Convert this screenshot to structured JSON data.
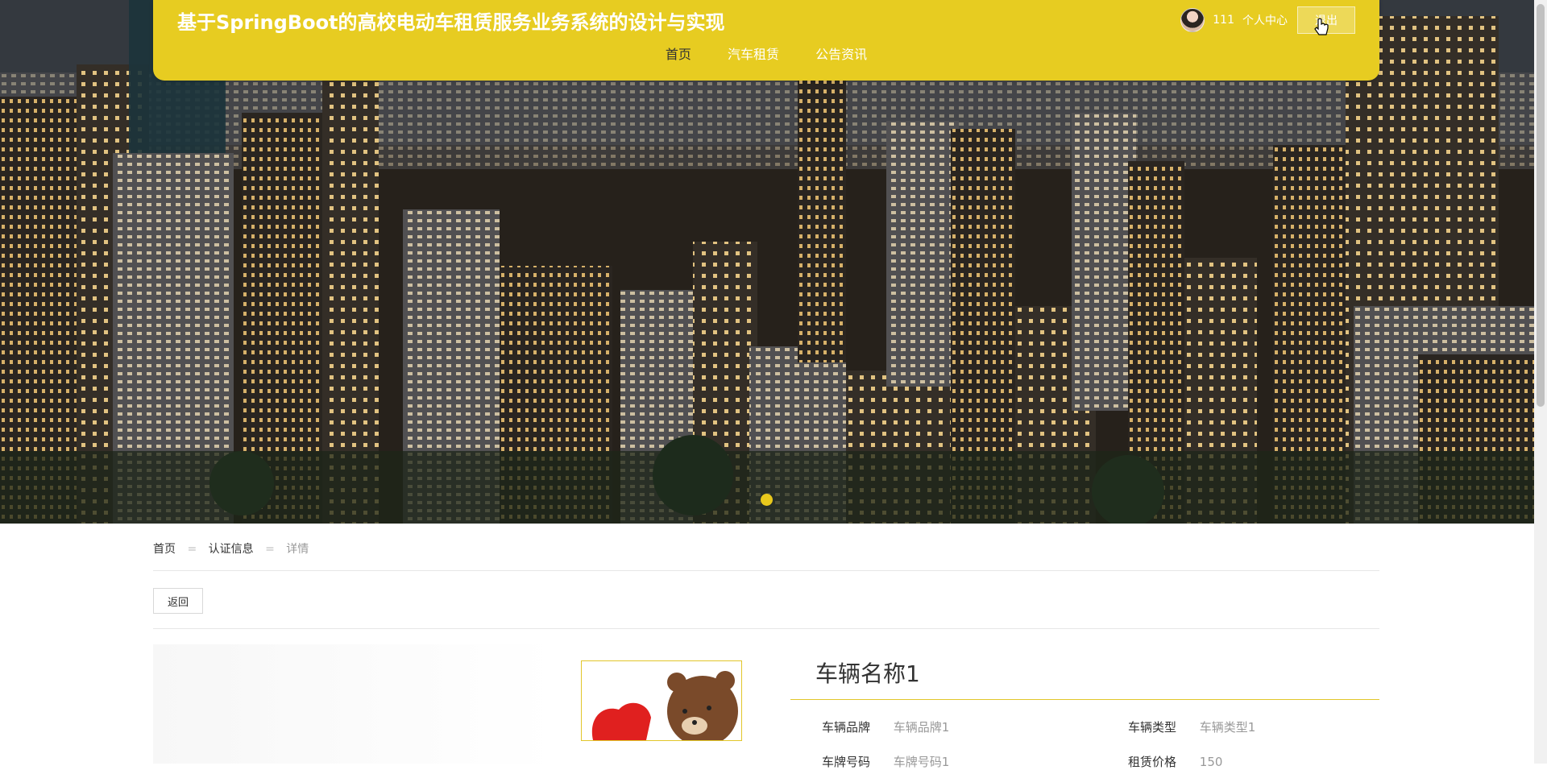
{
  "header": {
    "site_title": "基于SpringBoot的高校电动车租赁服务业务系统的设计与实现",
    "nav": [
      {
        "label": "首页",
        "active": true
      },
      {
        "label": "汽车租赁",
        "active": false
      },
      {
        "label": "公告资讯",
        "active": false
      }
    ],
    "user": {
      "username": "111",
      "user_center_label": "个人中心",
      "logout_label": "退出",
      "avatar_icon": "user-avatar"
    }
  },
  "hero": {
    "image": "city-night-skyline",
    "slider_dots": 1,
    "active_dot_color": "#e8c81c"
  },
  "breadcrumb": {
    "items": [
      "首页",
      "认证信息",
      "详情"
    ],
    "separator": "="
  },
  "actions": {
    "back_label": "返回"
  },
  "detail": {
    "vehicle_name": "车辆名称1",
    "thumbnail": "cartoon-bear-heart",
    "fields": [
      {
        "key": "车辆品牌",
        "value": "车辆品牌1"
      },
      {
        "key": "车辆类型",
        "value": "车辆类型1"
      },
      {
        "key": "车牌号码",
        "value": "车牌号码1"
      },
      {
        "key": "租赁价格",
        "value": "150"
      }
    ]
  },
  "theme": {
    "accent": "#e7cc21",
    "text": "#333333",
    "muted": "#999999"
  }
}
